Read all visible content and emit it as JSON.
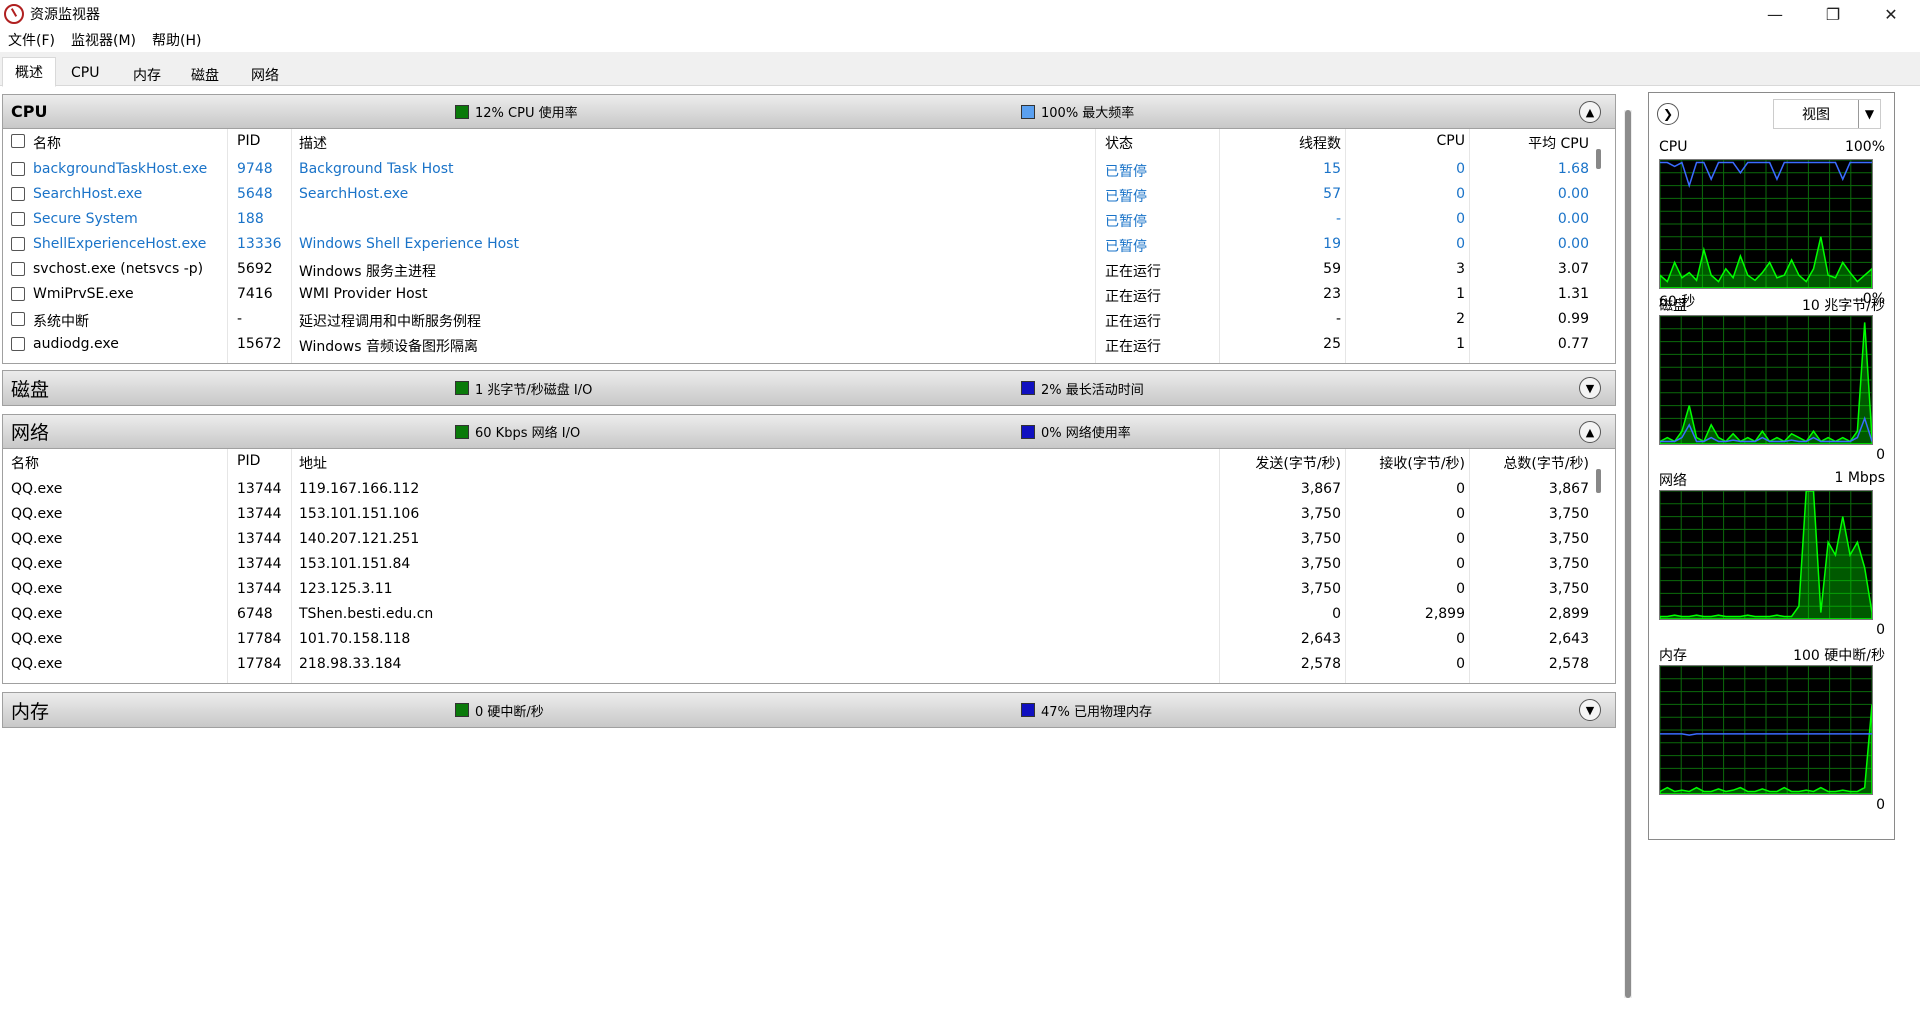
{
  "window": {
    "title": "资源监视器"
  },
  "menu": [
    "文件(F)",
    "监视器(M)",
    "帮助(H)"
  ],
  "tabs": [
    "概述",
    "CPU",
    "内存",
    "磁盘",
    "网络"
  ],
  "cpu": {
    "title": "CPU",
    "stat1": "12% CPU 使用率",
    "stat2": "100% 最大频率",
    "stat1_color": "#0a7a0a",
    "stat2_color": "#5aa0f0",
    "columns": [
      "名称",
      "PID",
      "描述",
      "状态",
      "线程数",
      "CPU",
      "平均 CPU"
    ],
    "rows": [
      {
        "name": "backgroundTaskHost.exe",
        "pid": "9748",
        "desc": "Background Task Host",
        "status": "已暂停",
        "threads": "15",
        "cpu": "0",
        "avg": "1.68",
        "suspended": true
      },
      {
        "name": "SearchHost.exe",
        "pid": "5648",
        "desc": "SearchHost.exe",
        "status": "已暂停",
        "threads": "57",
        "cpu": "0",
        "avg": "0.00",
        "suspended": true
      },
      {
        "name": "Secure System",
        "pid": "188",
        "desc": "",
        "status": "已暂停",
        "threads": "-",
        "cpu": "0",
        "avg": "0.00",
        "suspended": true
      },
      {
        "name": "ShellExperienceHost.exe",
        "pid": "13336",
        "desc": "Windows Shell Experience Host",
        "status": "已暂停",
        "threads": "19",
        "cpu": "0",
        "avg": "0.00",
        "suspended": true
      },
      {
        "name": "svchost.exe (netsvcs -p)",
        "pid": "5692",
        "desc": "Windows 服务主进程",
        "status": "正在运行",
        "threads": "59",
        "cpu": "3",
        "avg": "3.07",
        "suspended": false
      },
      {
        "name": "WmiPrvSE.exe",
        "pid": "7416",
        "desc": "WMI Provider Host",
        "status": "正在运行",
        "threads": "23",
        "cpu": "1",
        "avg": "1.31",
        "suspended": false
      },
      {
        "name": "系统中断",
        "pid": "-",
        "desc": "延迟过程调用和中断服务例程",
        "status": "正在运行",
        "threads": "-",
        "cpu": "2",
        "avg": "0.99",
        "suspended": false
      },
      {
        "name": "audiodg.exe",
        "pid": "15672",
        "desc": "Windows 音频设备图形隔离",
        "status": "正在运行",
        "threads": "25",
        "cpu": "1",
        "avg": "0.77",
        "suspended": false
      }
    ]
  },
  "disk": {
    "title": "磁盘",
    "stat1": "1 兆字节/秒磁盘 I/O",
    "stat2": "2% 最长活动时间",
    "stat1_color": "#0a7a0a",
    "stat2_color": "#1010c0"
  },
  "network": {
    "title": "网络",
    "stat1": "60 Kbps 网络 I/O",
    "stat2": "0% 网络使用率",
    "stat1_color": "#0a7a0a",
    "stat2_color": "#1010c0",
    "columns": [
      "名称",
      "PID",
      "地址",
      "发送(字节/秒)",
      "接收(字节/秒)",
      "总数(字节/秒)"
    ],
    "rows": [
      {
        "name": "QQ.exe",
        "pid": "13744",
        "addr": "119.167.166.112",
        "send": "3,867",
        "recv": "0",
        "total": "3,867"
      },
      {
        "name": "QQ.exe",
        "pid": "13744",
        "addr": "153.101.151.106",
        "send": "3,750",
        "recv": "0",
        "total": "3,750"
      },
      {
        "name": "QQ.exe",
        "pid": "13744",
        "addr": "140.207.121.251",
        "send": "3,750",
        "recv": "0",
        "total": "3,750"
      },
      {
        "name": "QQ.exe",
        "pid": "13744",
        "addr": "153.101.151.84",
        "send": "3,750",
        "recv": "0",
        "total": "3,750"
      },
      {
        "name": "QQ.exe",
        "pid": "13744",
        "addr": "123.125.3.11",
        "send": "3,750",
        "recv": "0",
        "total": "3,750"
      },
      {
        "name": "QQ.exe",
        "pid": "6748",
        "addr": "TShen.besti.edu.cn",
        "send": "0",
        "recv": "2,899",
        "total": "2,899"
      },
      {
        "name": "QQ.exe",
        "pid": "17784",
        "addr": "101.70.158.118",
        "send": "2,643",
        "recv": "0",
        "total": "2,643"
      },
      {
        "name": "QQ.exe",
        "pid": "17784",
        "addr": "218.98.33.184",
        "send": "2,578",
        "recv": "0",
        "total": "2,578"
      }
    ]
  },
  "memory": {
    "title": "内存",
    "stat1": "0 硬中断/秒",
    "stat2": "47% 已用物理内存",
    "stat1_color": "#0a7a0a",
    "stat2_color": "#1010c0"
  },
  "side": {
    "view_label": "视图",
    "graphs": [
      {
        "title": "CPU",
        "max": "100%",
        "foot_left": "60 秒",
        "foot_right": "0%"
      },
      {
        "title": "磁盘",
        "max": "10 兆字节/秒",
        "foot_left": "",
        "foot_right": "0"
      },
      {
        "title": "网络",
        "max": "1 Mbps",
        "foot_left": "",
        "foot_right": "0"
      },
      {
        "title": "内存",
        "max": "100 硬中断/秒",
        "foot_left": "",
        "foot_right": "0"
      }
    ]
  }
}
